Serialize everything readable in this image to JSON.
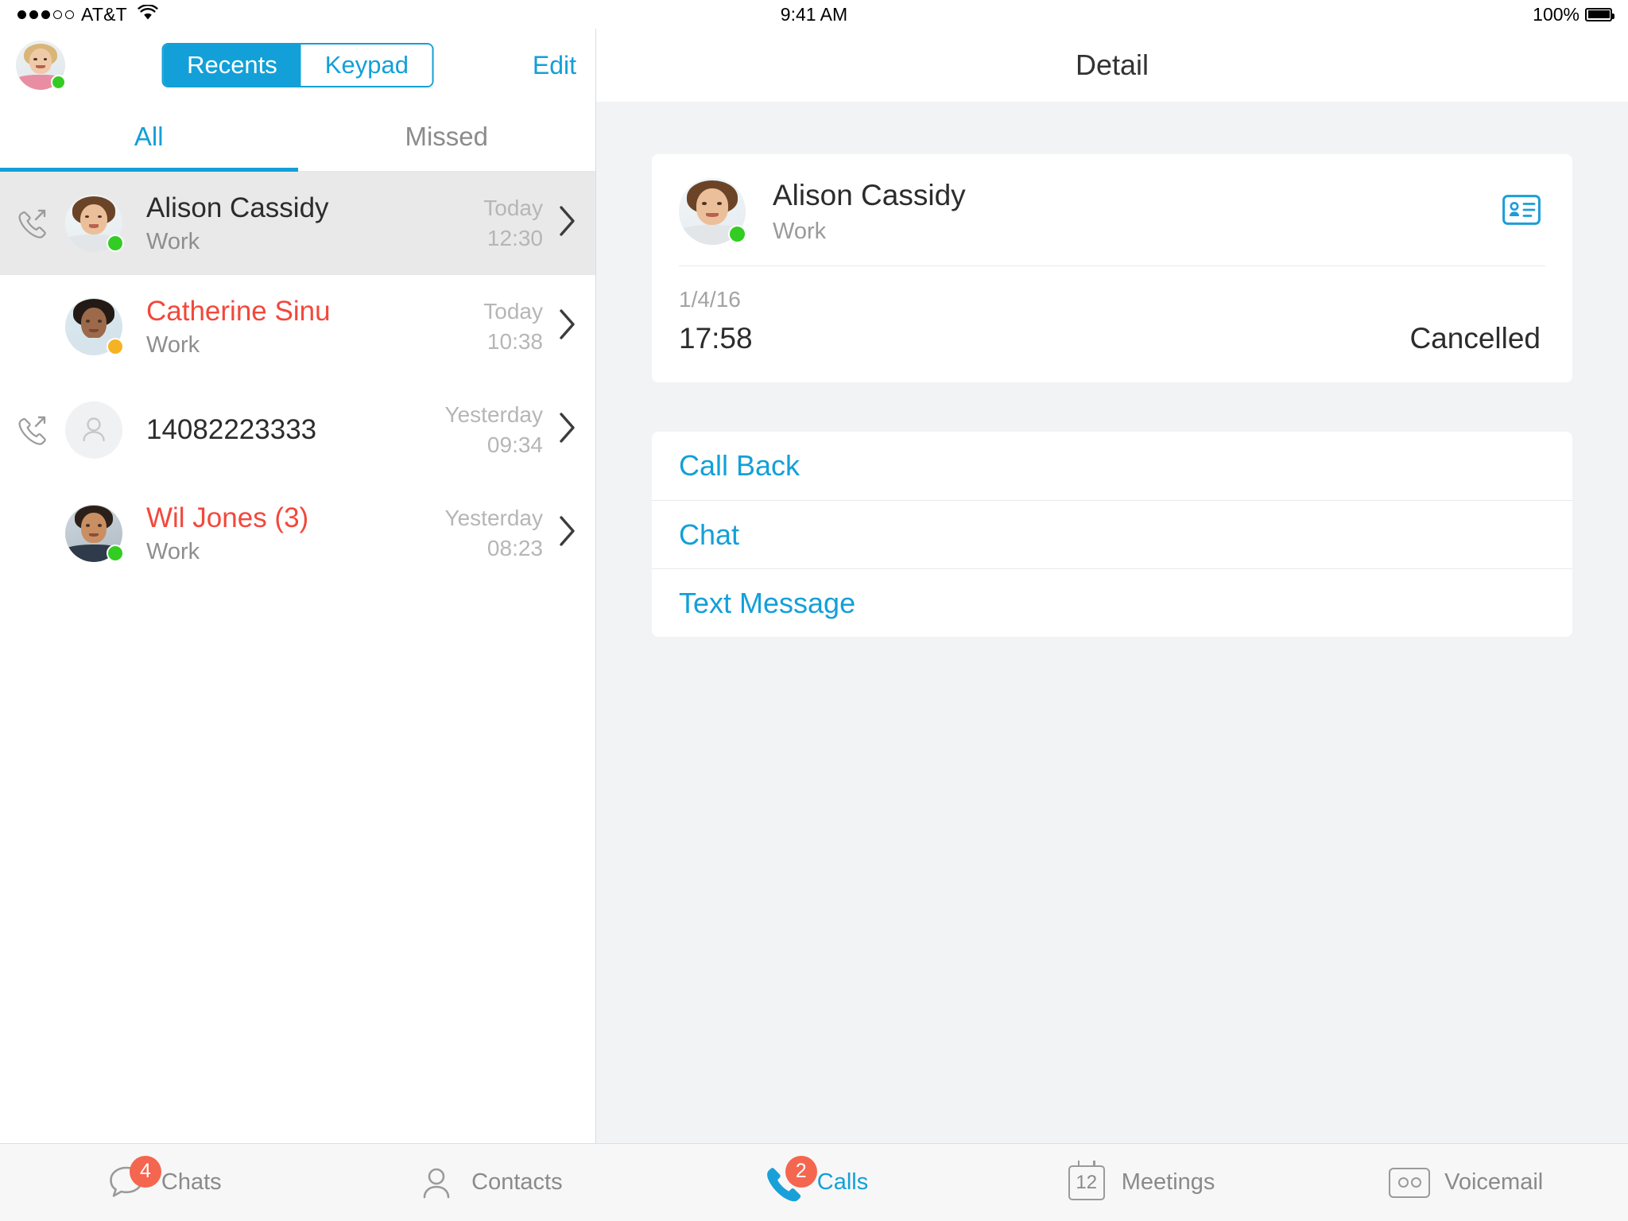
{
  "status_bar": {
    "signal_dots_filled": 3,
    "signal_dots_total": 5,
    "carrier": "AT&T",
    "wifi_icon": "wifi-icon",
    "time": "9:41 AM",
    "battery_percent": "100%",
    "battery_icon": "battery-full-icon"
  },
  "left_header": {
    "avatar": {
      "name": "user-avatar",
      "presence": "available",
      "presence_color": "#33cc22"
    },
    "segmented": {
      "options": [
        {
          "label": "Recents",
          "selected": true
        },
        {
          "label": "Keypad",
          "selected": false
        }
      ]
    },
    "edit_label": "Edit"
  },
  "left_tabs": [
    {
      "label": "All",
      "active": true
    },
    {
      "label": "Missed",
      "active": false
    }
  ],
  "calls": [
    {
      "name": "Alison Cassidy",
      "subtitle": "Work",
      "day": "Today",
      "time": "12:30",
      "missed": false,
      "direction_icon": "outgoing-call-icon",
      "presence": "available",
      "presence_color": "#33cc22",
      "selected": true,
      "has_avatar_photo": true,
      "chevron_icon": "chevron-right-icon"
    },
    {
      "name": "Catherine Sinu",
      "subtitle": "Work",
      "day": "Today",
      "time": "10:38",
      "missed": true,
      "direction_icon": "",
      "presence": "away",
      "presence_color": "#f5b323",
      "selected": false,
      "has_avatar_photo": true,
      "chevron_icon": "chevron-right-icon"
    },
    {
      "name": "14082223333",
      "subtitle": "",
      "day": "Yesterday",
      "time": "09:34",
      "missed": false,
      "direction_icon": "outgoing-call-icon",
      "presence": "",
      "presence_color": "",
      "selected": false,
      "has_avatar_photo": false,
      "chevron_icon": "chevron-right-icon"
    },
    {
      "name": "Wil Jones (3)",
      "subtitle": "Work",
      "day": "Yesterday",
      "time": "08:23",
      "missed": true,
      "direction_icon": "",
      "presence": "available",
      "presence_color": "#33cc22",
      "selected": false,
      "has_avatar_photo": true,
      "chevron_icon": "chevron-right-icon"
    }
  ],
  "detail": {
    "title": "Detail",
    "contact": {
      "name": "Alison Cassidy",
      "subtitle": "Work",
      "presence": "available",
      "presence_color": "#33cc22",
      "contact_card_icon": "contact-card-icon"
    },
    "call_record": {
      "date": "1/4/16",
      "time": "17:58",
      "status": "Cancelled"
    },
    "actions": [
      {
        "label": "Call Back"
      },
      {
        "label": "Chat"
      },
      {
        "label": "Text Message"
      }
    ]
  },
  "tabbar": [
    {
      "label": "Chats",
      "icon": "chat-bubble-icon",
      "badge": "4",
      "active": false
    },
    {
      "label": "Contacts",
      "icon": "person-icon",
      "badge": "",
      "active": false
    },
    {
      "label": "Calls",
      "icon": "phone-icon",
      "badge": "2",
      "active": true
    },
    {
      "label": "Meetings",
      "icon": "calendar-icon",
      "badge": "",
      "calendar_day": "12",
      "active": false
    },
    {
      "label": "Voicemail",
      "icon": "voicemail-icon",
      "badge": "",
      "active": false
    }
  ],
  "colors": {
    "accent": "#13a0d8",
    "missed": "#f2483c",
    "badge": "#f4664f",
    "available": "#33cc22",
    "away": "#f5b323",
    "pane_bg": "#f2f3f4"
  }
}
